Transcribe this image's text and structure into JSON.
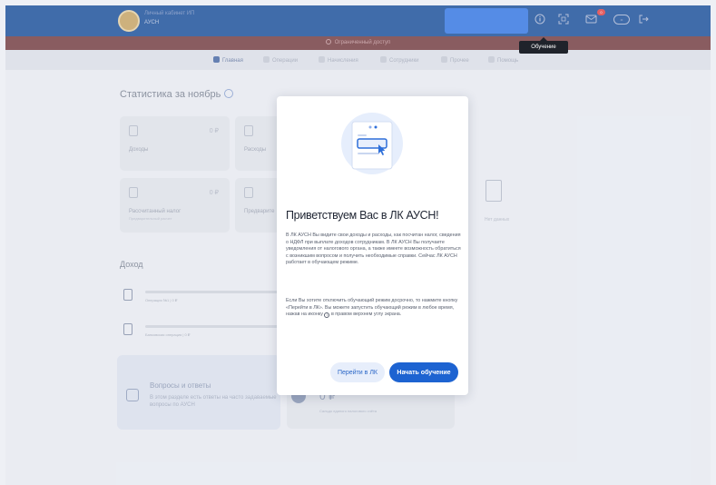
{
  "header": {
    "logo_line1": "Личный кабинет ИП",
    "logo_line2": "АУСН",
    "notification_count": "0",
    "icons": [
      "help-icon",
      "qr-icon",
      "mail-icon",
      "account-pill-icon",
      "logout-icon"
    ],
    "tooltip": "Обучение"
  },
  "banner": {
    "text": "Ограниченный доступ"
  },
  "nav": {
    "items": [
      {
        "label": "Главная",
        "active": true
      },
      {
        "label": "Операции"
      },
      {
        "label": "Начисления"
      },
      {
        "label": "Сотрудники"
      },
      {
        "label": "Прочее"
      },
      {
        "label": "Помощь"
      }
    ]
  },
  "stats": {
    "title": "Статистика за ноябрь",
    "cards": [
      {
        "label": "Доходы",
        "value": "0 ₽"
      },
      {
        "label": "Расходы",
        "value": ""
      },
      {
        "label": "Рассчитанный налог",
        "sub": "Предварительный расчет",
        "value": "0 ₽"
      },
      {
        "label": "Предварите",
        "value": ""
      }
    ],
    "empty_label": "Нет данных"
  },
  "income": {
    "title": "Доход",
    "rows": [
      {
        "text": "Операция №1 | 0 ₽"
      },
      {
        "text": "Банковская операция | 0 ₽"
      }
    ]
  },
  "faq": {
    "title": "Вопросы и ответы",
    "subtitle": "В этом разделе есть ответы на часто задаваемые вопросы по АУСН"
  },
  "balance": {
    "value": "0 ₽",
    "sub": "Сальдо единого налогового счёта"
  },
  "modal": {
    "title": "Приветствуем Вас в ЛК АУСН!",
    "p1": "В ЛК АУСН Вы видите свои доходы и расходы, как посчитан налог, сведения о НДФЛ при выплате доходов сотрудникам. В ЛК АУСН Вы получаете уведомления от налогового органа, а также имеете возможность обратиться с возникшим вопросом и получить необходимые справки. Сейчас ЛК АУСН работает в обучающем режиме.",
    "p2_before": "Если Вы хотите отключить обучающий режим досрочно, то нажмите кнопку «Перейти в ЛК». Вы можете запустить обучающий режим в любое время, нажав на иконку",
    "p2_after": "в правом верхнем углу экрана.",
    "inline_icon": "i",
    "btn_secondary": "Перейти в ЛК",
    "btn_primary": "Начать обучение"
  },
  "colors": {
    "header_bg": "#24579f",
    "banner_bg": "#7a4548",
    "primary_button": "#1d63d1",
    "secondary_button": "#e7eefb"
  }
}
